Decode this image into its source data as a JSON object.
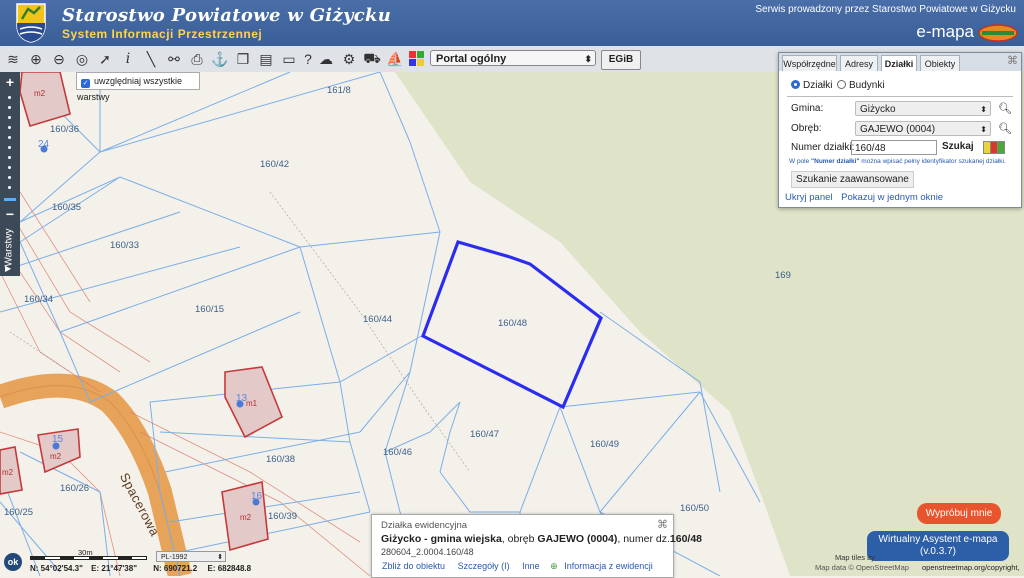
{
  "header": {
    "title": "Starostwo Powiatowe w Giżycku",
    "subtitle": "System Informacji Przestrzennej",
    "service_note": "Serwis prowadzony przez Starostwo Powiatowe w Giżycku",
    "brand": "e-mapa"
  },
  "toolbar": {
    "tools": [
      "layers-icon",
      "zoom-in-icon",
      "zoom-out-icon",
      "zoom-extent-icon",
      "pointer-icon",
      "info-icon",
      "measure-icon",
      "link-icon",
      "print-icon",
      "anchor-icon",
      "copy-icon",
      "layout-icon",
      "comment-icon",
      "help-icon",
      "cloud-icon",
      "settings-icon",
      "cart-icon",
      "sailboat-icon",
      "color-grid-icon"
    ],
    "portal_select": "Portal ogólny",
    "egib_button": "EGiB"
  },
  "layers_box": {
    "label": "uwzględniaj wszystkie warstwy",
    "checked": true
  },
  "left_panel": {
    "warstwy_tab": "Warstwy",
    "zoom_plus": "+",
    "zoom_minus": "−"
  },
  "panel": {
    "tabs": [
      "Współrzędne",
      "Adresy",
      "Działki",
      "Obiekty"
    ],
    "active_tab": "Działki",
    "radio_options": [
      "Działki",
      "Budynki"
    ],
    "selected_radio": "Działki",
    "gmina_label": "Gmina:",
    "gmina_value": "Giżycko",
    "obreb_label": "Obręb:",
    "obreb_value": "GAJEWO (0004)",
    "numer_label": "Numer działki:",
    "numer_value": "160/48",
    "search_button": "Szukaj",
    "hint_prefix": "W pole ",
    "hint_field": "\"Numer działki\"",
    "hint_suffix": " można wpisać pełny identyfikator szukanej działki.",
    "advanced_button": "Szukanie zaawansowane",
    "hide_panel_link": "Ukryj panel",
    "show_one_window_link": "Pokazuj w jednym oknie"
  },
  "info": {
    "title": "Działka ewidencyjna",
    "desc_location": "Giżycko - gmina wiejska",
    "desc_mid": ", obręb ",
    "desc_obreb": "GAJEWO (0004)",
    "desc_mid2": ", numer dz.",
    "desc_number": "160/48",
    "identifier": "280604_2.0004.160/48",
    "links": [
      "Zbliż do obiektu",
      "Szczegóły (I)",
      "Inne",
      "Informacja z ewidencji"
    ]
  },
  "map": {
    "parcels": [
      "161/8",
      "160/42",
      "160/36",
      "160/35",
      "160/33",
      "160/34",
      "160/15",
      "160/44",
      "160/48",
      "169",
      "160/47",
      "160/46",
      "160/49",
      "160/38",
      "160/26",
      "160/25",
      "160/39",
      "160/50"
    ],
    "building_labels": [
      "m2",
      "m1",
      "m2",
      "m2",
      "m2"
    ],
    "address_numbers": [
      "24",
      "13",
      "15",
      "16"
    ],
    "street_name": "Spacerowa"
  },
  "statusbar": {
    "ok_button": "ok",
    "scale_label": "30m",
    "projection": "PL-1992",
    "coord_lat": "N: 54°02'54.3\"",
    "coord_lon": "E: 21°47'38\"",
    "coord_n": "N: 690721.2",
    "coord_e": "E: 682848.8"
  },
  "assistant": {
    "try_button": "Wypróbuj mnie",
    "title": "Wirtualny Asystent e-mapa",
    "version": "(v.0.3.7)"
  },
  "attribution": {
    "map_tiles": "Map tiles by",
    "map_data": "Map data © OpenStreetMap",
    "osm_link": "openstreetmap.org/copyright,"
  },
  "colors": {
    "header": "#4a6ea8",
    "subtitle": "#ffd34d",
    "selected_parcel": "#2b2cf0",
    "parcel_line": "#7aaee8",
    "forest": "#dfe3c8",
    "road": "#e8a35a",
    "try_button": "#e8542d",
    "assistant": "#2c5fa7"
  }
}
